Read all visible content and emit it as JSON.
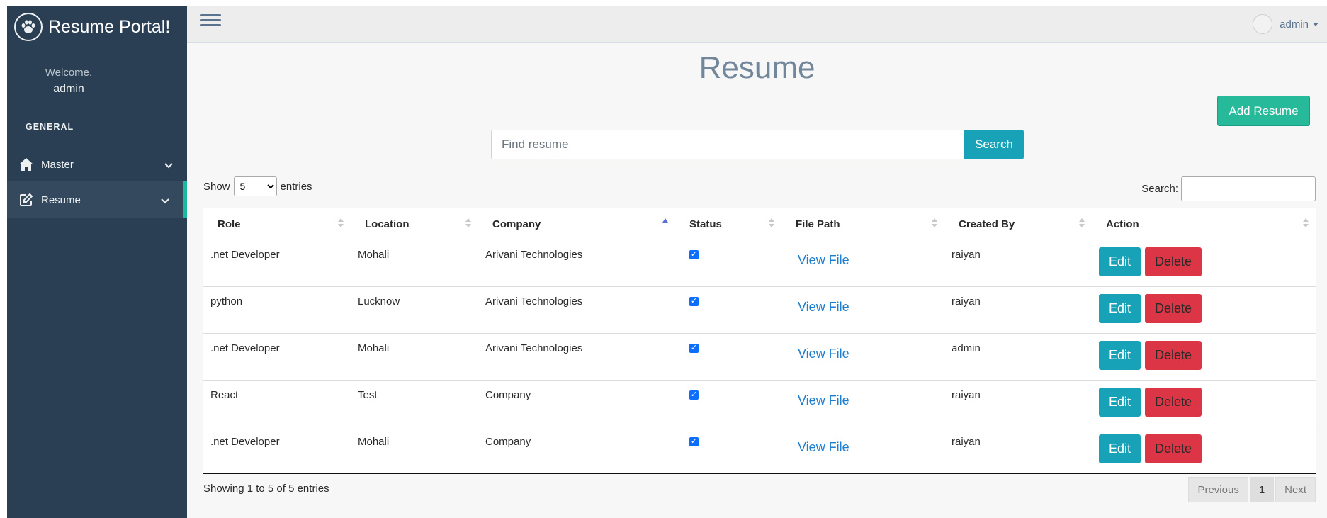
{
  "brand": {
    "title": "Resume Portal!",
    "logo_icon": "paw-icon"
  },
  "sidebar": {
    "welcome_label": "Welcome,",
    "welcome_user": "admin",
    "section_label": "GENERAL",
    "items": [
      {
        "label": "Master",
        "icon": "home-icon"
      },
      {
        "label": "Resume",
        "icon": "edit-icon"
      }
    ]
  },
  "topbar": {
    "user_name": "admin"
  },
  "page": {
    "title": "Resume",
    "add_button": "Add Resume",
    "search_placeholder": "Find resume",
    "search_button": "Search"
  },
  "table_controls": {
    "show_label": "Show",
    "entries_label": "entries",
    "page_length": "5",
    "filter_label": "Search:"
  },
  "table": {
    "columns": [
      "Role",
      "Location",
      "Company",
      "Status",
      "File Path",
      "Created By",
      "Action"
    ],
    "rows": [
      {
        "role": ".net Developer",
        "location": "Mohali",
        "company": "Arivani Technologies",
        "status": true,
        "file_link": "View File",
        "created_by": "raiyan"
      },
      {
        "role": "python",
        "location": "Lucknow",
        "company": "Arivani Technologies",
        "status": true,
        "file_link": "View File",
        "created_by": "raiyan"
      },
      {
        "role": ".net Developer",
        "location": "Mohali",
        "company": "Arivani Technologies",
        "status": true,
        "file_link": "View File",
        "created_by": "admin"
      },
      {
        "role": "React",
        "location": "Test",
        "company": "Company",
        "status": true,
        "file_link": "View File",
        "created_by": "raiyan"
      },
      {
        "role": ".net Developer",
        "location": "Mohali",
        "company": "Company",
        "status": true,
        "file_link": "View File",
        "created_by": "raiyan"
      }
    ],
    "edit_label": "Edit",
    "delete_label": "Delete"
  },
  "footer": {
    "info": "Showing 1 to 5 of 5 entries",
    "previous": "Previous",
    "current_page": "1",
    "next": "Next"
  },
  "colors": {
    "sidebar_bg": "#2a3f54",
    "accent_green": "#26b99a",
    "info_teal": "#17a2b8",
    "danger_red": "#dc3545",
    "link_blue": "#1e7ecf"
  }
}
